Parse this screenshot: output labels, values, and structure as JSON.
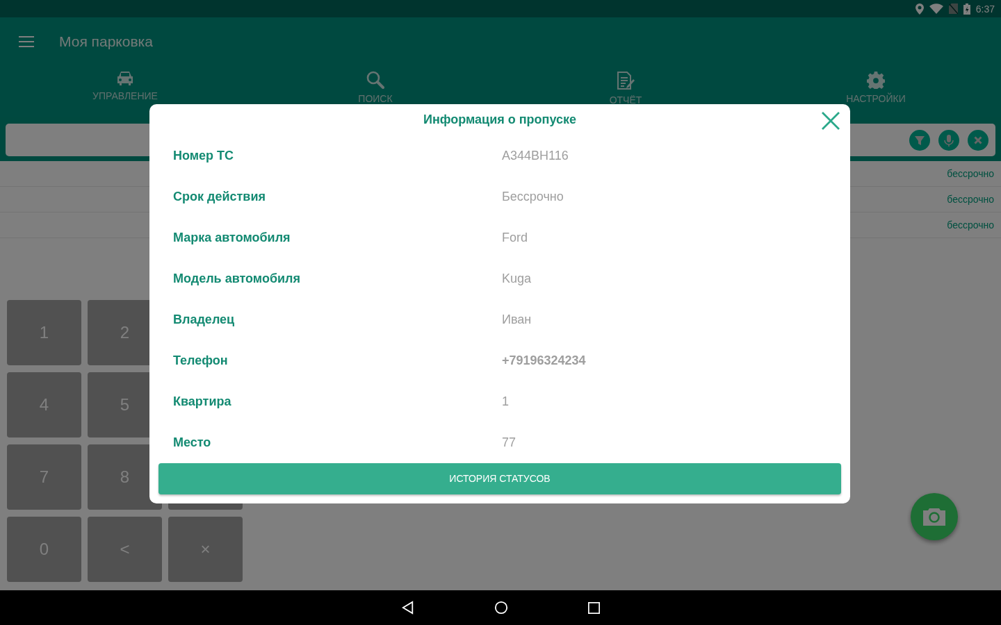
{
  "status_bar": {
    "time": "6:37"
  },
  "app_bar": {
    "title": "Моя парковка"
  },
  "tabs": [
    {
      "label": "УПРАВЛЕНИЕ",
      "kind": "car"
    },
    {
      "label": "ПОИСК",
      "kind": "search"
    },
    {
      "label": "ОТЧЁТ",
      "kind": "report"
    },
    {
      "label": "НАСТРОЙКИ",
      "kind": "settings"
    }
  ],
  "list": [
    {
      "validity": "бессрочно"
    },
    {
      "validity": "бессрочно"
    },
    {
      "validity": "бессрочно"
    }
  ],
  "keypad": [
    [
      "1",
      "2"
    ],
    [
      "4",
      "5"
    ],
    [
      "7",
      "8"
    ],
    [
      "0",
      "<",
      "×"
    ]
  ],
  "dialog": {
    "title": "Информация о пропуске",
    "rows": [
      {
        "label": "Номер ТС",
        "value": "А344ВН116",
        "bold": false
      },
      {
        "label": "Срок действия",
        "value": "Бессрочно",
        "bold": false
      },
      {
        "label": "Марка автомобиля",
        "value": "Ford",
        "bold": false
      },
      {
        "label": "Модель автомобиля",
        "value": "Kuga",
        "bold": false
      },
      {
        "label": "Владелец",
        "value": "Иван",
        "bold": false
      },
      {
        "label": "Телефон",
        "value": "+79196324234",
        "bold": true
      },
      {
        "label": "Квартира",
        "value": "1",
        "bold": false
      },
      {
        "label": "Место",
        "value": "77",
        "bold": false
      }
    ],
    "button": "ИСТОРИЯ СТАТУСОВ"
  }
}
